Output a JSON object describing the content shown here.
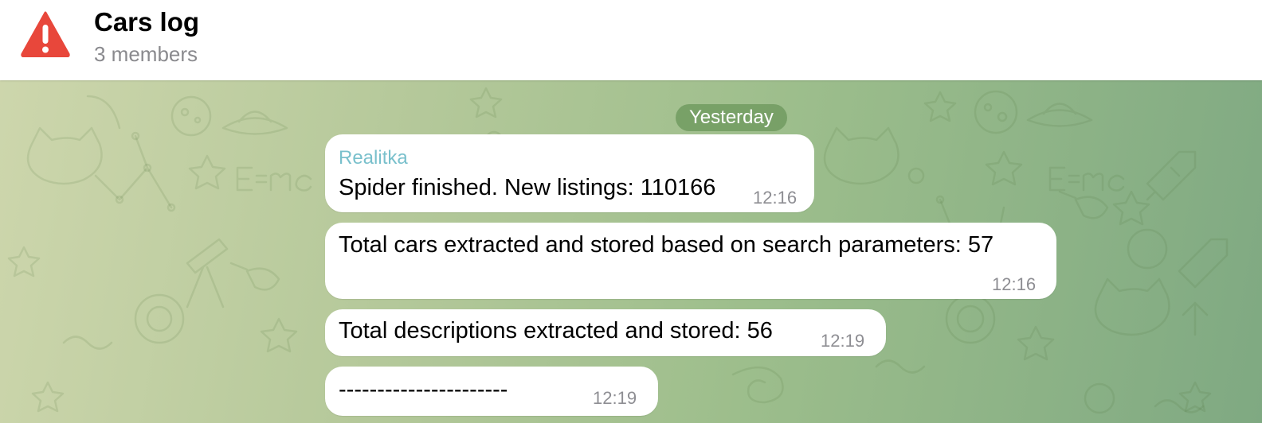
{
  "chat": {
    "title": "Cars log",
    "subtitle": "3 members",
    "avatar_icon": "warning-icon",
    "avatar_color": "#e8473b",
    "date_separator": "Yesterday"
  },
  "messages": [
    {
      "sender": "Realitka",
      "text": "Spider finished. New listings: 110166",
      "time": "12:16"
    },
    {
      "text": "Total cars extracted and stored based on search parameters: 57",
      "time": "12:16"
    },
    {
      "text": "Total descriptions extracted and stored: 56",
      "time": "12:19"
    },
    {
      "text": "----------------------",
      "time": "12:19"
    }
  ],
  "colors": {
    "sender_name": "#79c0cc",
    "bubble": "#ffffff",
    "date_pill": "#719b60"
  }
}
